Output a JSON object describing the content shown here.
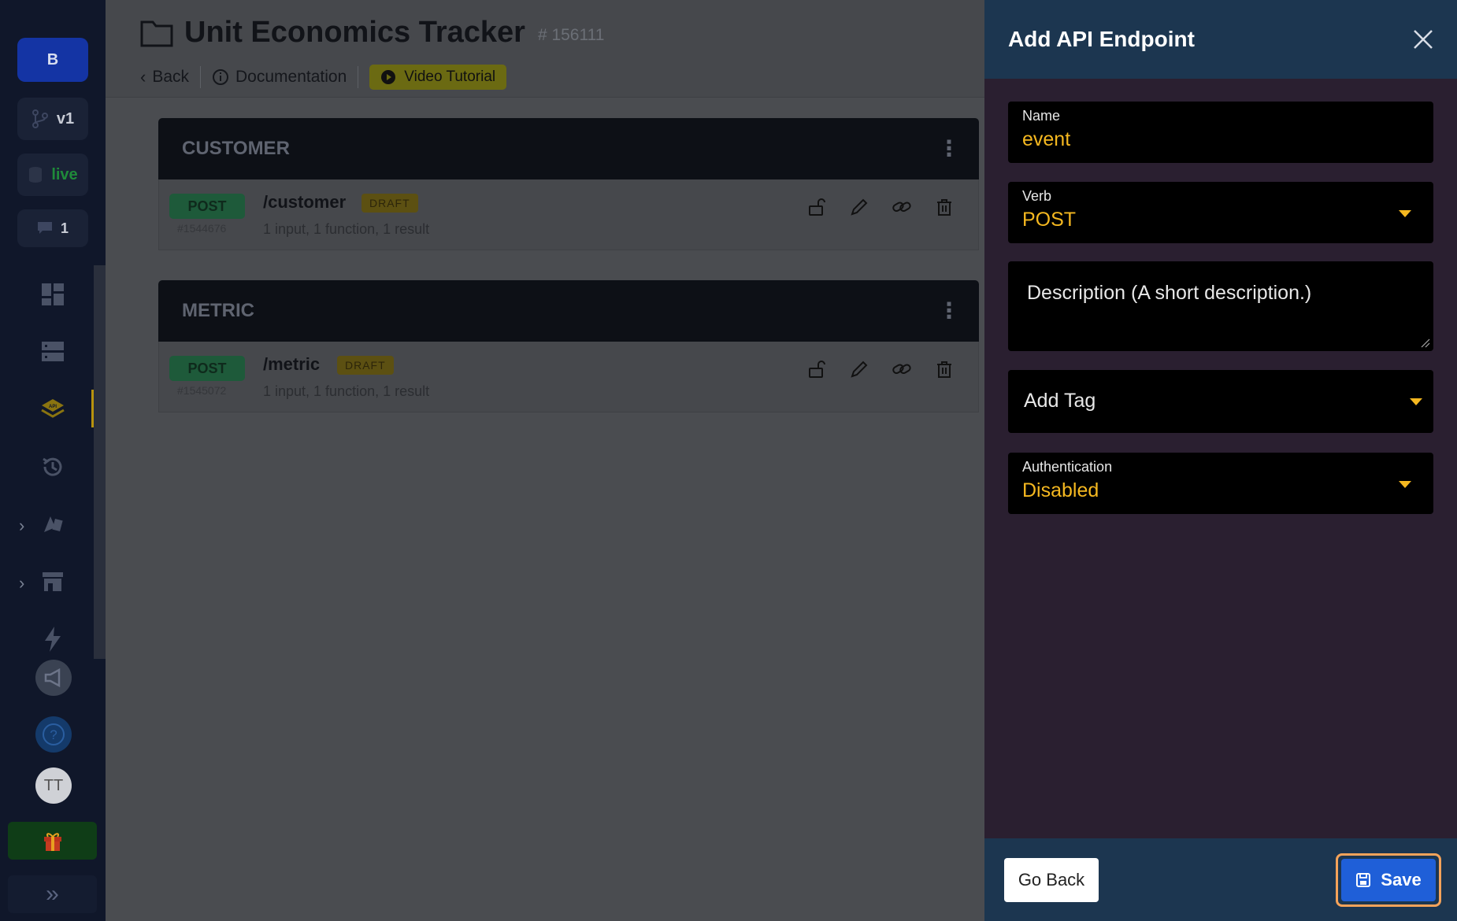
{
  "sidebar": {
    "brand_initial": "B",
    "branch_label": "v1",
    "env_label": "live",
    "comments_count": "1",
    "avatar_initials": "TT"
  },
  "header": {
    "title": "Unit Economics Tracker",
    "id": "# 156111",
    "back": "Back",
    "documentation": "Documentation",
    "video_tutorial": "Video Tutorial"
  },
  "groups": [
    {
      "name": "CUSTOMER",
      "endpoint": {
        "verb": "POST",
        "id": "#1544676",
        "path": "/customer",
        "status": "DRAFT",
        "summary": "1 input, 1 function, 1 result"
      }
    },
    {
      "name": "METRIC",
      "endpoint": {
        "verb": "POST",
        "id": "#1545072",
        "path": "/metric",
        "status": "DRAFT",
        "summary": "1 input, 1 function, 1 result"
      }
    }
  ],
  "panel": {
    "title": "Add API Endpoint",
    "name_label": "Name",
    "name_value": "event",
    "verb_label": "Verb",
    "verb_value": "POST",
    "description_placeholder": "Description (A short description.)",
    "tag_placeholder": "Add Tag",
    "auth_label": "Authentication",
    "auth_value": "Disabled",
    "go_back": "Go Back",
    "save": "Save"
  },
  "colors": {
    "accent": "#f5b820",
    "save_button": "#1f5fd8",
    "panel_header": "#1c3650"
  }
}
